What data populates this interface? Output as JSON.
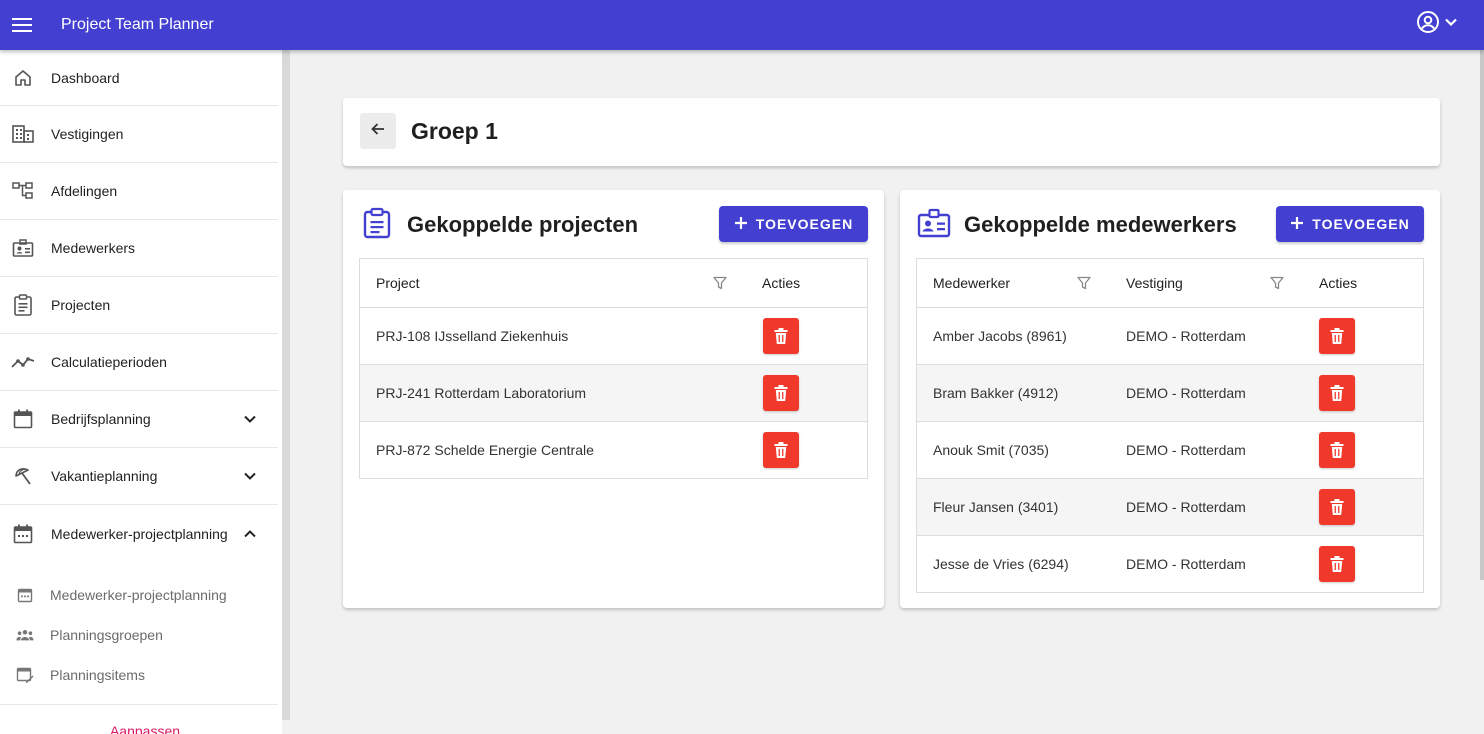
{
  "app": {
    "title": "Project Team Planner"
  },
  "sidebar": {
    "items": [
      {
        "label": "Dashboard",
        "icon": "home-icon"
      },
      {
        "label": "Vestigingen",
        "icon": "building-icon"
      },
      {
        "label": "Afdelingen",
        "icon": "org-chart-icon"
      },
      {
        "label": "Medewerkers",
        "icon": "id-badge-icon"
      },
      {
        "label": "Projecten",
        "icon": "clipboard-icon"
      },
      {
        "label": "Calculatieperioden",
        "icon": "trending-line-icon"
      },
      {
        "label": "Bedrijfsplanning",
        "icon": "calendar-icon",
        "expandable": true,
        "expanded": false
      },
      {
        "label": "Vakantieplanning",
        "icon": "beach-umbrella-icon",
        "expandable": true,
        "expanded": false
      },
      {
        "label": "Medewerker-projectplanning",
        "icon": "calendar-icon",
        "expandable": true,
        "expanded": true
      }
    ],
    "sub_items": [
      {
        "label": "Medewerker-projectplanning",
        "icon": "calendar-icon"
      },
      {
        "label": "Planningsgroepen",
        "icon": "group-icon"
      },
      {
        "label": "Planningsitems",
        "icon": "calendar-edit-icon"
      }
    ],
    "customize_label": "Aanpassen"
  },
  "page": {
    "title": "Groep 1"
  },
  "projects_card": {
    "title": "Gekoppelde projecten",
    "add_label": "TOEVOEGEN",
    "columns": [
      "Project",
      "Acties"
    ],
    "rows": [
      "PRJ-108 IJsselland Ziekenhuis",
      "PRJ-241 Rotterdam Laboratorium",
      "PRJ-872 Schelde Energie Centrale"
    ]
  },
  "employees_card": {
    "title": "Gekoppelde medewerkers",
    "add_label": "TOEVOEGEN",
    "columns": [
      "Medewerker",
      "Vestiging",
      "Acties"
    ],
    "rows": [
      {
        "name": "Amber Jacobs (8961)",
        "location": "DEMO - Rotterdam"
      },
      {
        "name": "Bram Bakker (4912)",
        "location": "DEMO - Rotterdam"
      },
      {
        "name": "Anouk Smit (7035)",
        "location": "DEMO - Rotterdam"
      },
      {
        "name": "Fleur Jansen (3401)",
        "location": "DEMO - Rotterdam"
      },
      {
        "name": "Jesse de Vries (6294)",
        "location": "DEMO - Rotterdam"
      }
    ]
  },
  "colors": {
    "primary": "#4340d1",
    "danger": "#f0392b",
    "accent_link": "#d81b60"
  }
}
